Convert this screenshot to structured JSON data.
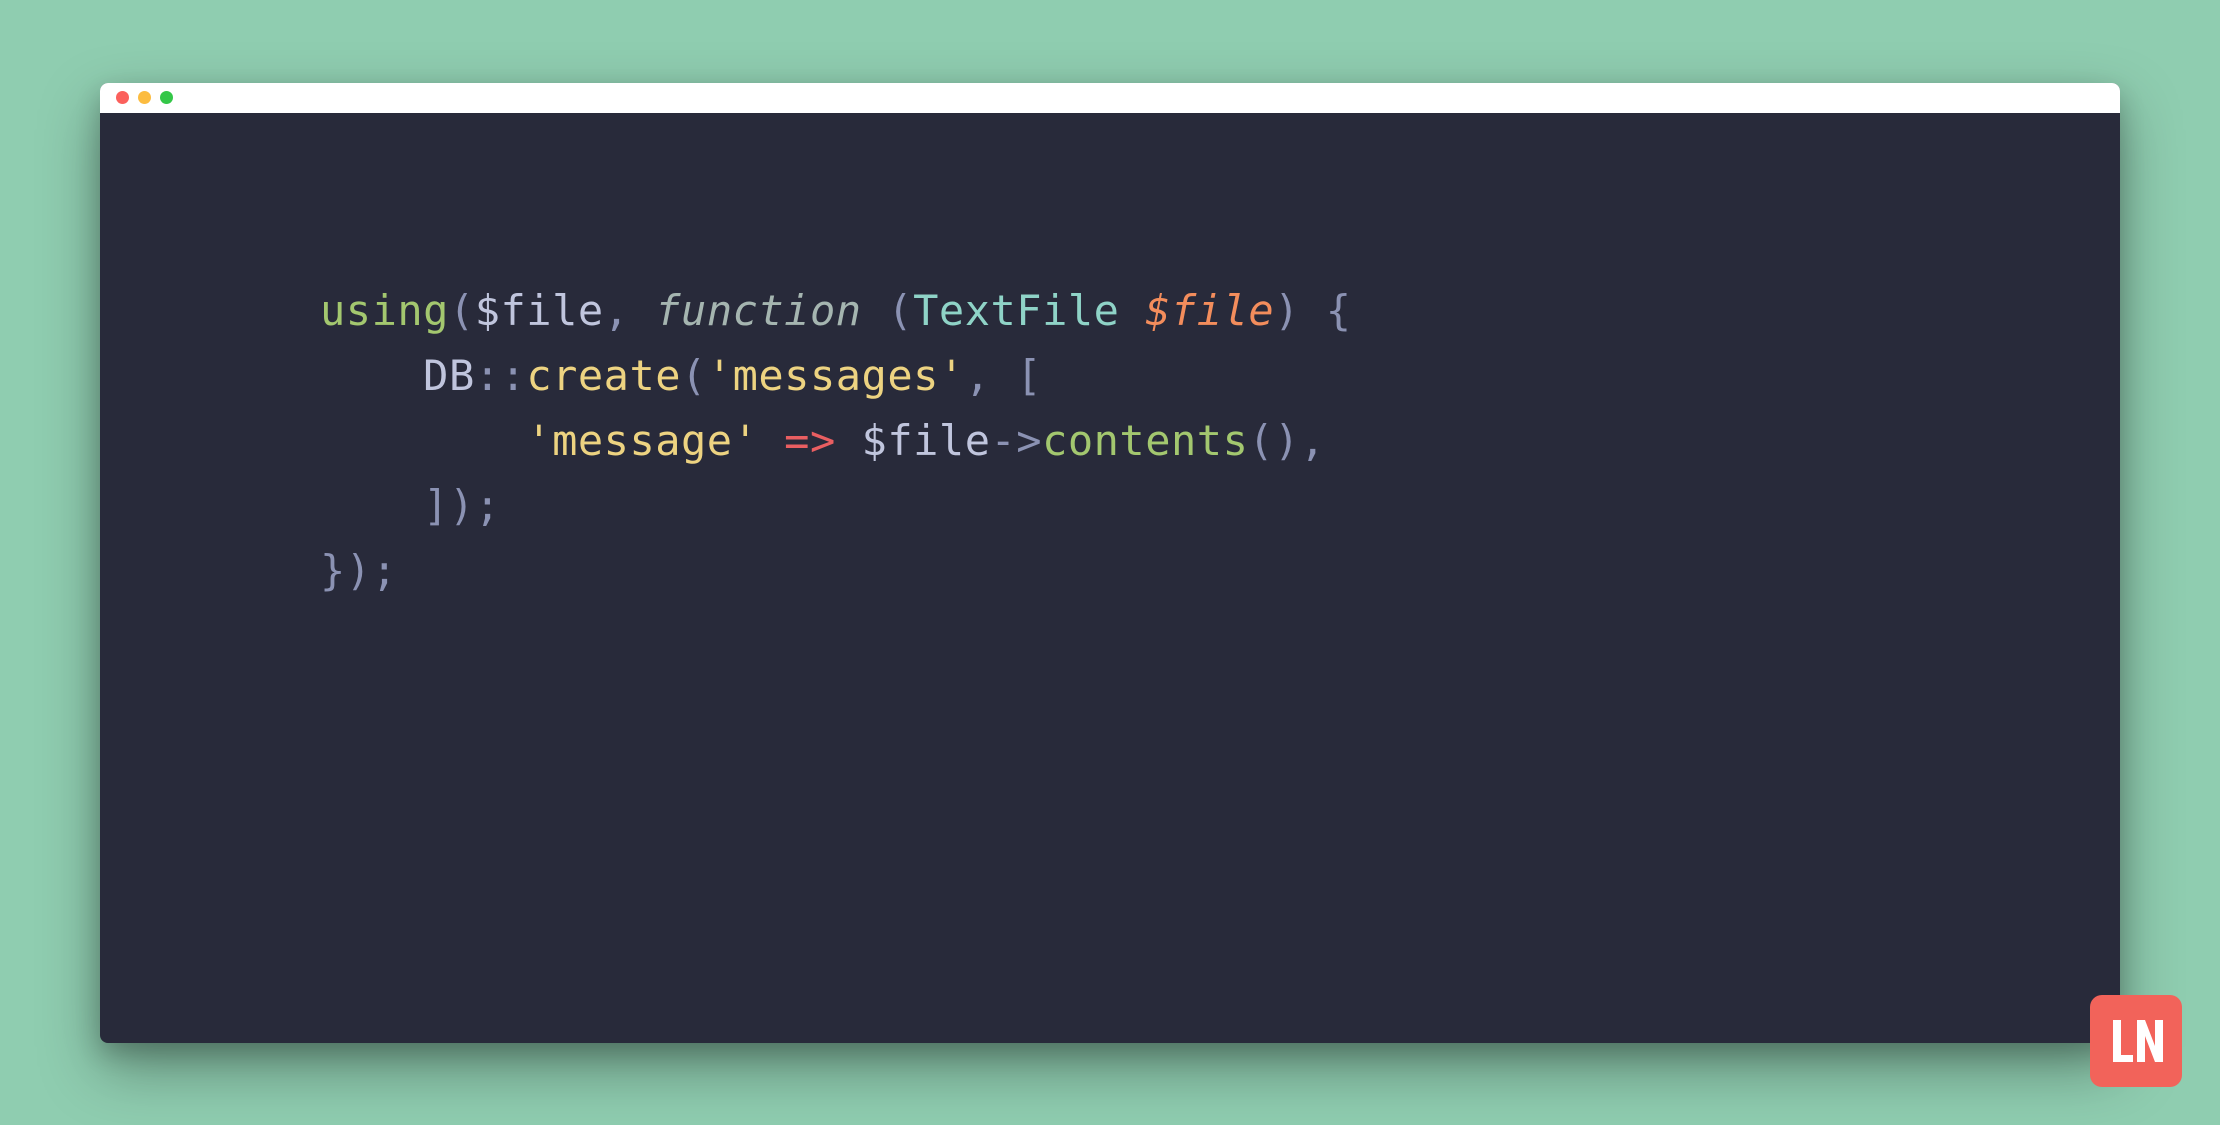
{
  "code": {
    "line1": {
      "t1": "using",
      "t2": "(",
      "t3": "$file",
      "t4": ", ",
      "t5": "function",
      "t6": " ",
      "t7": "(",
      "t8": "TextFile",
      "t9": " ",
      "t10": "$file",
      "t11": ")",
      "t12": " {"
    },
    "line2": {
      "indent": "    ",
      "t1": "DB",
      "t2": "::",
      "t3": "create",
      "t4": "(",
      "t5": "'messages'",
      "t6": ", ["
    },
    "line3": {
      "indent": "        ",
      "t1": "'message'",
      "t2": " ",
      "t3": "=>",
      "t4": " ",
      "t5": "$file",
      "t6": "->",
      "t7": "contents",
      "t8": "(),"
    },
    "line4": {
      "indent": "    ",
      "t1": "]);"
    },
    "line5": {
      "t1": "});"
    }
  },
  "logo": {
    "text": "LN"
  }
}
